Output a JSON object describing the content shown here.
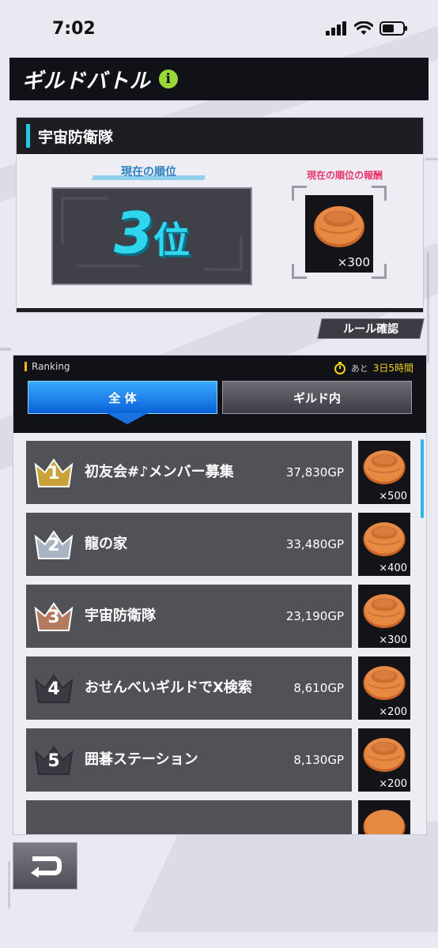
{
  "status_bar": {
    "time": "7:02"
  },
  "header": {
    "title": "ギルドバトル",
    "info_symbol": "i"
  },
  "guild": {
    "name": "宇宙防衛隊",
    "rank_label": "現在の順位",
    "rank_value": "3",
    "rank_unit": "位",
    "reward_label": "現在の順位の報酬",
    "reward_count": "×300"
  },
  "rules_button": "ルール確認",
  "ranking": {
    "label": "Ranking",
    "time_prefix": "あと",
    "time_remaining": "3日5時間",
    "tabs": {
      "all": "全 体",
      "guild": "ギルド内"
    },
    "rows": [
      {
        "rank": "1",
        "name": "初友会#♪メンバー募集",
        "gp": "37,830GP",
        "reward": "×500",
        "tier": "gold"
      },
      {
        "rank": "2",
        "name": "龍の家",
        "gp": "33,480GP",
        "reward": "×400",
        "tier": "silver"
      },
      {
        "rank": "3",
        "name": "宇宙防衛隊",
        "gp": "23,190GP",
        "reward": "×300",
        "tier": "bronze"
      },
      {
        "rank": "4",
        "name": "おせんべいギルドでX検索",
        "gp": "8,610GP",
        "reward": "×200",
        "tier": "plain"
      },
      {
        "rank": "5",
        "name": "囲碁ステーション",
        "gp": "8,130GP",
        "reward": "×200",
        "tier": "plain"
      }
    ]
  },
  "colors": {
    "accent_cyan": "#2fd6ee",
    "tab_active": "#1a72e0",
    "gold": "#c9a33a",
    "silver": "#a8b4c2",
    "bronze": "#b47a5e"
  }
}
